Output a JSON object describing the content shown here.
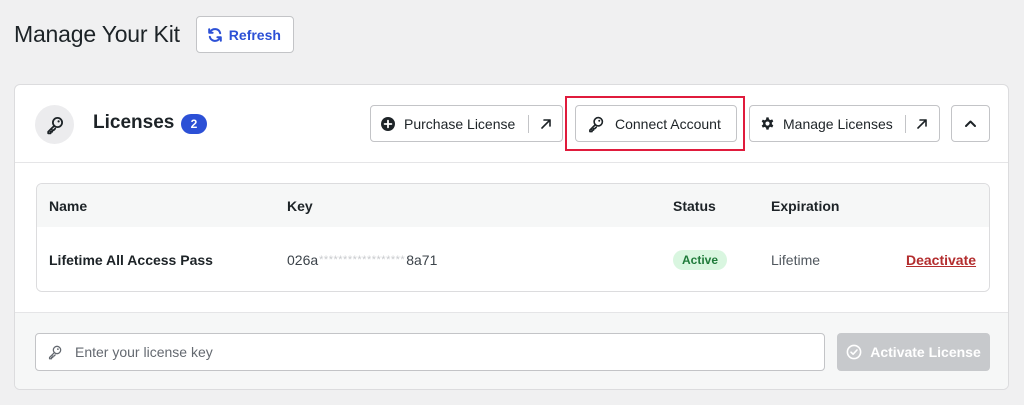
{
  "header": {
    "title": "Manage Your Kit",
    "refresh_label": "Refresh"
  },
  "licenses": {
    "title": "Licenses",
    "count": "2",
    "actions": {
      "purchase_label": "Purchase License",
      "connect_label": "Connect Account",
      "manage_label": "Manage Licenses"
    },
    "table": {
      "columns": [
        "Name",
        "Key",
        "Status",
        "Expiration"
      ],
      "rows": [
        {
          "name": "Lifetime All Access Pass",
          "key_prefix": "026a",
          "key_mask": "******************",
          "key_suffix": "8a71",
          "status": "Active",
          "expiration": "Lifetime",
          "action": "Deactivate"
        }
      ]
    },
    "footer": {
      "input_placeholder": "Enter your license key",
      "activate_label": "Activate License"
    }
  },
  "colors": {
    "accent": "#2c50d6",
    "highlight": "#e01b3c",
    "danger": "#b32d2e",
    "active_bg": "#d9f6e0",
    "active_text": "#1f7a3a"
  },
  "icons": {
    "refresh": "refresh-icon",
    "key": "key-icon",
    "plus_circle": "plus-circle-icon",
    "external": "external-arrow-icon",
    "gear": "gear-icon",
    "chevron_up": "chevron-up-icon",
    "check_circle": "check-circle-icon"
  }
}
